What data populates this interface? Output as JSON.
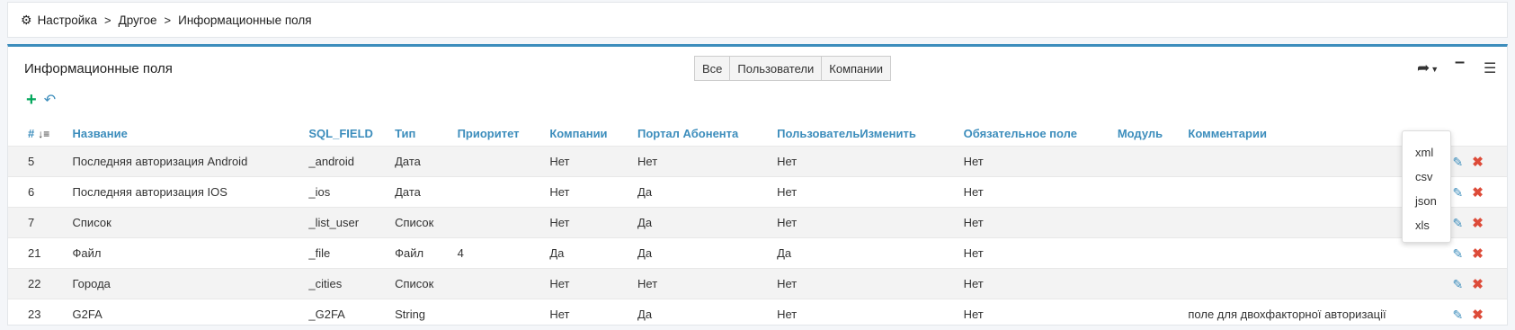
{
  "breadcrumb": {
    "icon": "gear-icon",
    "items": [
      "Настройка",
      "Другое",
      "Информационные поля"
    ],
    "separator": ">"
  },
  "card": {
    "title": "Информационные поля",
    "filters": [
      "Все",
      "Пользователи",
      "Компании"
    ],
    "tools": {
      "share_icon": "share-icon",
      "minimize_icon": "minus-icon",
      "columns_icon": "bars-icon"
    },
    "export_menu": [
      "xml",
      "csv",
      "json",
      "xls"
    ]
  },
  "colors": {
    "accent": "#3c8dbc",
    "add": "#00a65a",
    "delete": "#dd4b39"
  },
  "table": {
    "headers": [
      "#",
      "Название",
      "SQL_FIELD",
      "Тип",
      "Приоритет",
      "Компании",
      "Портал Абонента",
      "ПользовательИзменить",
      "Обязательное поле",
      "Модуль",
      "Комментарии"
    ],
    "rows": [
      {
        "id": "5",
        "name": "Последняя авторизация Android",
        "sql": "_android",
        "type": "Дата",
        "priority": "",
        "companies": "Нет",
        "portal": "Нет",
        "user_edit": "Нет",
        "required": "Нет",
        "module": "",
        "comment": ""
      },
      {
        "id": "6",
        "name": "Последняя авторизация IOS",
        "sql": "_ios",
        "type": "Дата",
        "priority": "",
        "companies": "Нет",
        "portal": "Да",
        "user_edit": "Нет",
        "required": "Нет",
        "module": "",
        "comment": ""
      },
      {
        "id": "7",
        "name": "Список",
        "sql": "_list_user",
        "type": "Список",
        "priority": "",
        "companies": "Нет",
        "portal": "Да",
        "user_edit": "Нет",
        "required": "Нет",
        "module": "",
        "comment": ""
      },
      {
        "id": "21",
        "name": "Файл",
        "sql": "_file",
        "type": "Файл",
        "priority": "4",
        "companies": "Да",
        "portal": "Да",
        "user_edit": "Да",
        "required": "Нет",
        "module": "",
        "comment": ""
      },
      {
        "id": "22",
        "name": "Города",
        "sql": "_cities",
        "type": "Список",
        "priority": "",
        "companies": "Нет",
        "portal": "Нет",
        "user_edit": "Нет",
        "required": "Нет",
        "module": "",
        "comment": ""
      },
      {
        "id": "23",
        "name": "G2FA",
        "sql": "_G2FA",
        "type": "String",
        "priority": "",
        "companies": "Нет",
        "portal": "Да",
        "user_edit": "Нет",
        "required": "Нет",
        "module": "",
        "comment": "поле для двохфакторної авторизації"
      }
    ]
  }
}
